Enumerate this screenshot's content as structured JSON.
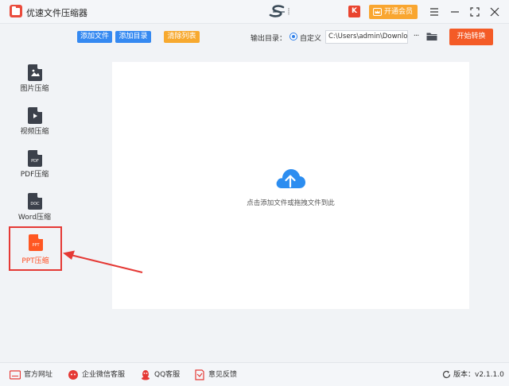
{
  "app": {
    "title": "优速文件压缩器"
  },
  "titlebar": {
    "status_dot": "⸽",
    "k_badge": "K",
    "vip_label": "开通会员"
  },
  "sidebar": {
    "items": [
      {
        "label": "图片压缩",
        "tag": ""
      },
      {
        "label": "视频压缩",
        "tag": ""
      },
      {
        "label": "PDF压缩",
        "tag": "PDF"
      },
      {
        "label": "Word压缩",
        "tag": "DOC"
      },
      {
        "label": "PPT压缩",
        "tag": "PPT",
        "active": true
      }
    ]
  },
  "toolbar": {
    "add_file": "添加文件",
    "add_folder": "添加目录",
    "clear_list": "清除列表",
    "output_dir_label": "输出目录：",
    "custom_label": "自定义",
    "output_path": "C:\\Users\\admin\\Downlo",
    "more": "···",
    "start": "开始转换"
  },
  "dropzone": {
    "hint": "点击添加文件或拖拽文件到此"
  },
  "footer": {
    "website": "官方网址",
    "wechat": "企业微信客服",
    "qq": "QQ客服",
    "feedback": "意见反馈",
    "version": "版本：v2.1.1.0"
  },
  "colors": {
    "accent_blue": "#3589f1",
    "accent_orange": "#f7a92f",
    "start_red": "#f45b27",
    "active_outline": "#e53935",
    "annotation_arrow": "#e53935"
  }
}
